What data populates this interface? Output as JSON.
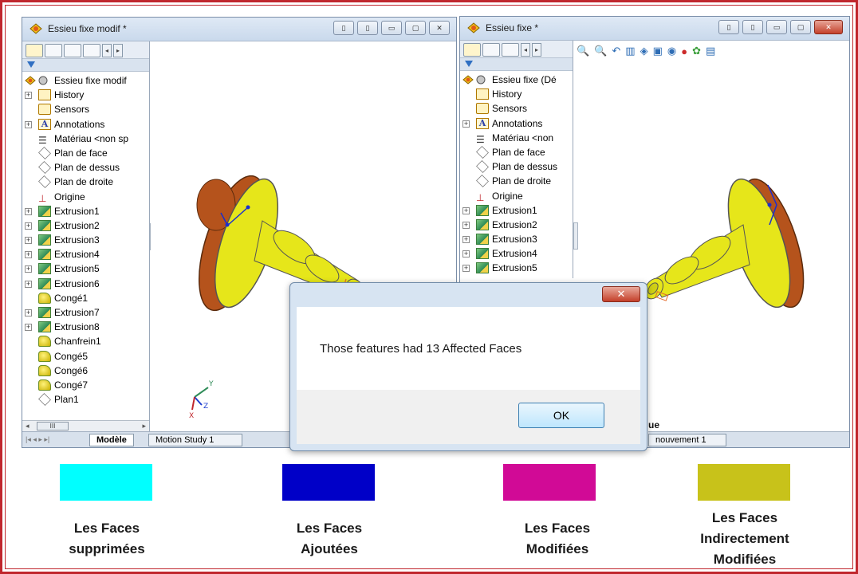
{
  "left_window": {
    "title": "Essieu fixe modif *",
    "root_label": "Essieu fixe modif",
    "tree": [
      {
        "label": "History",
        "icon": "history-icon",
        "expandable": true
      },
      {
        "label": "Sensors",
        "icon": "sensors-icon",
        "expandable": false
      },
      {
        "label": "Annotations",
        "icon": "annotations-icon",
        "expandable": true
      },
      {
        "label": "Matériau <non sp",
        "icon": "material-icon",
        "expandable": false
      },
      {
        "label": "Plan de face",
        "icon": "plane-icon",
        "expandable": false
      },
      {
        "label": "Plan de dessus",
        "icon": "plane-icon",
        "expandable": false
      },
      {
        "label": "Plan de droite",
        "icon": "plane-icon",
        "expandable": false
      },
      {
        "label": "Origine",
        "icon": "origin-icon",
        "expandable": false
      },
      {
        "label": "Extrusion1",
        "icon": "extrusion-icon",
        "expandable": true
      },
      {
        "label": "Extrusion2",
        "icon": "extrusion-icon",
        "expandable": true
      },
      {
        "label": "Extrusion3",
        "icon": "extrusion-icon",
        "expandable": true
      },
      {
        "label": "Extrusion4",
        "icon": "extrusion-icon",
        "expandable": true
      },
      {
        "label": "Extrusion5",
        "icon": "extrusion-icon",
        "expandable": true
      },
      {
        "label": "Extrusion6",
        "icon": "extrusion-icon",
        "expandable": true
      },
      {
        "label": "Congé1",
        "icon": "fillet-icon",
        "expandable": false
      },
      {
        "label": "Extrusion7",
        "icon": "extrusion-icon",
        "expandable": true
      },
      {
        "label": "Extrusion8",
        "icon": "extrusion-icon",
        "expandable": true
      },
      {
        "label": "Chanfrein1",
        "icon": "chamfer-icon",
        "expandable": false
      },
      {
        "label": "Congé5",
        "icon": "fillet-icon",
        "expandable": false
      },
      {
        "label": "Congé6",
        "icon": "fillet-icon",
        "expandable": false
      },
      {
        "label": "Congé7",
        "icon": "fillet-icon",
        "expandable": false
      },
      {
        "label": "Plan1",
        "icon": "plane-icon",
        "expandable": false
      }
    ],
    "tab_model": "Modèle",
    "tab_motion": "Motion Study 1",
    "scroll_glyph": "III"
  },
  "right_window": {
    "title": "Essieu fixe *",
    "root_label": "Essieu fixe  (Dé",
    "tree": [
      {
        "label": "History",
        "icon": "history-icon",
        "expandable": false
      },
      {
        "label": "Sensors",
        "icon": "sensors-icon",
        "expandable": false
      },
      {
        "label": "Annotations",
        "icon": "annotations-icon",
        "expandable": true
      },
      {
        "label": "Matériau <non",
        "icon": "material-icon",
        "expandable": false
      },
      {
        "label": "Plan de face",
        "icon": "plane-icon",
        "expandable": false
      },
      {
        "label": "Plan de dessus",
        "icon": "plane-icon",
        "expandable": false
      },
      {
        "label": "Plan de droite",
        "icon": "plane-icon",
        "expandable": false
      },
      {
        "label": "Origine",
        "icon": "origin-icon",
        "expandable": false
      },
      {
        "label": "Extrusion1",
        "icon": "extrusion-icon",
        "expandable": true
      },
      {
        "label": "Extrusion2",
        "icon": "extrusion-icon",
        "expandable": true
      },
      {
        "label": "Extrusion3",
        "icon": "extrusion-icon",
        "expandable": true
      },
      {
        "label": "Extrusion4",
        "icon": "extrusion-icon",
        "expandable": true
      },
      {
        "label": "Extrusion5",
        "icon": "extrusion-icon",
        "expandable": true
      }
    ],
    "viewport_fragment": "ue",
    "tab_motion_fragment": "nouvement 1"
  },
  "dialog": {
    "message": "Those features had  13  Affected Faces",
    "ok_label": "OK",
    "close_label": "✕"
  },
  "legend": [
    {
      "color": "#00ffff",
      "label": "Les Faces\nsupprimées"
    },
    {
      "color": "#0000c8",
      "label": "Les Faces\nAjoutées"
    },
    {
      "color": "#d10a96",
      "label": "Les Faces\nModifiées"
    },
    {
      "color": "#c8c21a",
      "label": "Les Faces\nIndirectement\nModifiées"
    }
  ],
  "colors": {
    "part_yellow": "#e6e61a",
    "part_brown": "#b5531c",
    "frame_red": "#c0272d"
  }
}
